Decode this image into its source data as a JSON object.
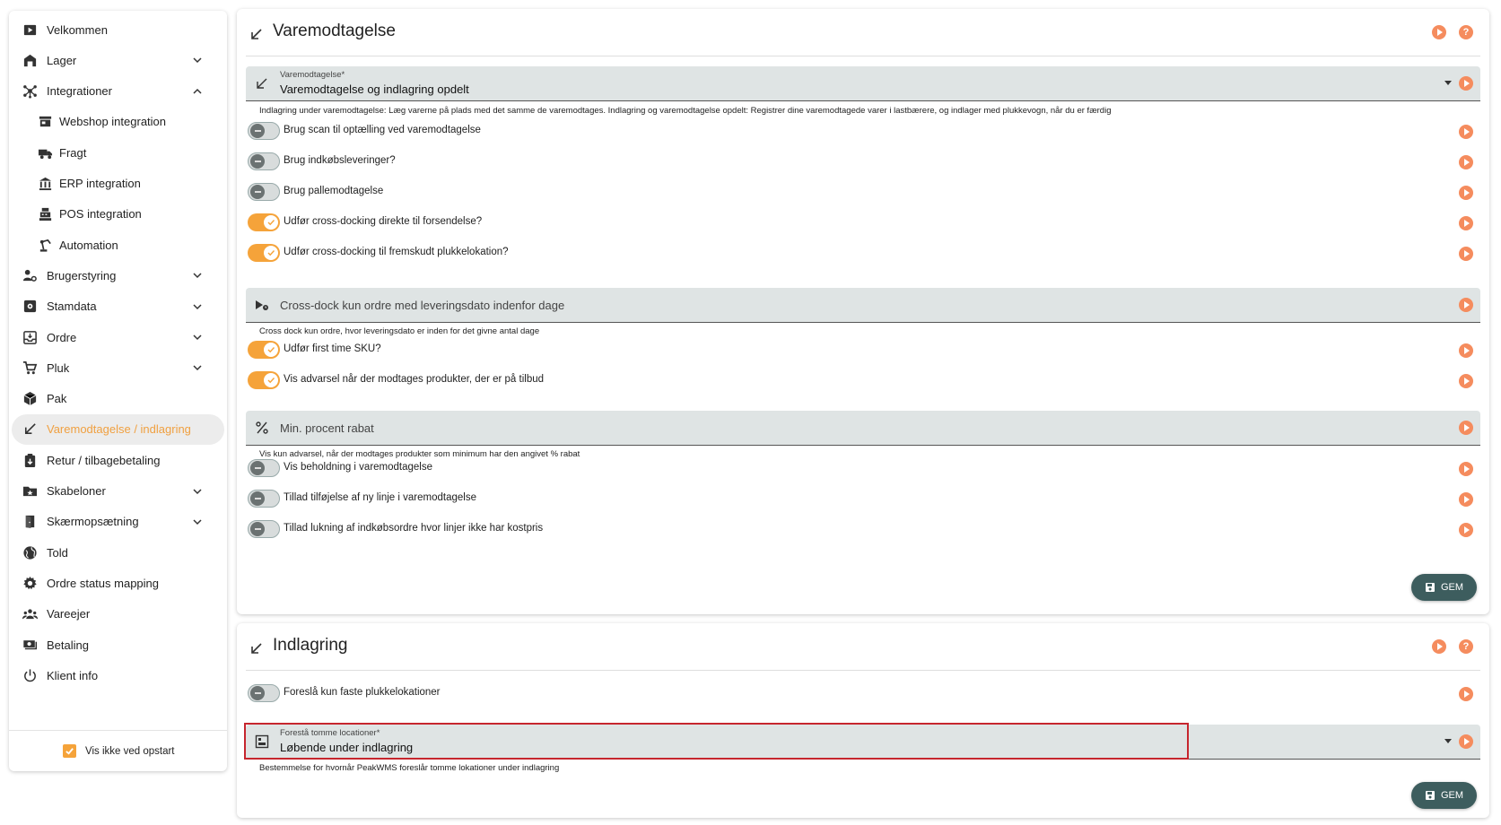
{
  "sidebar": {
    "items": [
      {
        "label": "Velkommen",
        "icon": "play-box-icon",
        "expandable": false,
        "indent": false,
        "active": false
      },
      {
        "label": "Lager",
        "icon": "warehouse-icon",
        "expandable": true,
        "expanded": false,
        "indent": false,
        "active": false
      },
      {
        "label": "Integrationer",
        "icon": "hub-icon",
        "expandable": true,
        "expanded": true,
        "indent": false,
        "active": false
      },
      {
        "label": "Webshop integration",
        "icon": "store-icon",
        "expandable": false,
        "indent": true,
        "active": false
      },
      {
        "label": "Fragt",
        "icon": "truck-icon",
        "expandable": false,
        "indent": true,
        "active": false
      },
      {
        "label": "ERP integration",
        "icon": "bank-icon",
        "expandable": false,
        "indent": true,
        "active": false
      },
      {
        "label": "POS integration",
        "icon": "cash-register-icon",
        "expandable": false,
        "indent": true,
        "active": false
      },
      {
        "label": "Automation",
        "icon": "robot-arm-icon",
        "expandable": false,
        "indent": true,
        "active": false
      },
      {
        "label": "Brugerstyring",
        "icon": "user-gear-icon",
        "expandable": true,
        "expanded": false,
        "indent": false,
        "active": false
      },
      {
        "label": "Stamdata",
        "icon": "gear-box-icon",
        "expandable": true,
        "expanded": false,
        "indent": false,
        "active": false
      },
      {
        "label": "Ordre",
        "icon": "inbox-icon",
        "expandable": true,
        "expanded": false,
        "indent": false,
        "active": false
      },
      {
        "label": "Pluk",
        "icon": "cart-icon",
        "expandable": true,
        "expanded": false,
        "indent": false,
        "active": false
      },
      {
        "label": "Pak",
        "icon": "package-icon",
        "expandable": false,
        "indent": false,
        "active": false
      },
      {
        "label": "Varemodtagelse / indlagring",
        "icon": "arrow-down-left-icon",
        "expandable": false,
        "indent": false,
        "active": true
      },
      {
        "label": "Retur / tilbagebetaling",
        "icon": "clipboard-return-icon",
        "expandable": false,
        "indent": false,
        "active": false
      },
      {
        "label": "Skabeloner",
        "icon": "folder-star-icon",
        "expandable": true,
        "expanded": false,
        "indent": false,
        "active": false
      },
      {
        "label": "Skærmopsætning",
        "icon": "door-icon",
        "expandable": true,
        "expanded": false,
        "indent": false,
        "active": false
      },
      {
        "label": "Told",
        "icon": "globe-icon",
        "expandable": false,
        "indent": false,
        "active": false
      },
      {
        "label": "Ordre status mapping",
        "icon": "gear-icon",
        "expandable": false,
        "indent": false,
        "active": false
      },
      {
        "label": "Vareejer",
        "icon": "people-icon",
        "expandable": false,
        "indent": false,
        "active": false
      },
      {
        "label": "Betaling",
        "icon": "money-icon",
        "expandable": false,
        "indent": false,
        "active": false
      },
      {
        "label": "Klient info",
        "icon": "power-icon",
        "expandable": false,
        "indent": false,
        "active": false
      }
    ],
    "startup_checkbox": {
      "label": "Vis ikke ved opstart",
      "checked": true
    }
  },
  "receiving": {
    "title": "Varemodtagelse",
    "select": {
      "label": "Varemodtagelse*",
      "value": "Varemodtagelse og indlagring opdelt",
      "helper": "Indlagring under varemodtagelse: Læg varerne på plads med det samme de varemodtages. Indlagring og varemodtagelse opdelt: Registrer dine varemodtagede varer i lastbærere, og indlager med plukkevogn, når du er færdig"
    },
    "toggles_a": [
      {
        "label": "Brug scan til optælling ved varemodtagelse",
        "on": false
      },
      {
        "label": "Brug indkøbsleveringer?",
        "on": false
      },
      {
        "label": "Brug pallemodtagelse",
        "on": false
      },
      {
        "label": "Udfør cross-docking direkte til forsendelse?",
        "on": true
      },
      {
        "label": "Udfør cross-docking til fremskudt plukkelokation?",
        "on": true
      }
    ],
    "crossdock_field": {
      "placeholder": "Cross-dock kun ordre med leveringsdato indenfor dage",
      "helper": "Cross dock kun ordre, hvor leveringsdato er inden for det givne antal dage"
    },
    "toggles_b": [
      {
        "label": "Udfør first time SKU?",
        "on": true
      },
      {
        "label": "Vis advarsel når der modtages produkter, der er på tilbud",
        "on": true
      }
    ],
    "discount_field": {
      "placeholder": "Min. procent rabat",
      "helper": "Vis kun advarsel, når der modtages produkter som minimum har den angivet % rabat"
    },
    "toggles_c": [
      {
        "label": "Vis beholdning i varemodtagelse",
        "on": false
      },
      {
        "label": "Tillad tilføjelse af ny linje i varemodtagelse",
        "on": false
      },
      {
        "label": "Tillad lukning af indkøbsordre hvor linjer ikke har kostpris",
        "on": false
      }
    ],
    "save_label": "GEM"
  },
  "putaway": {
    "title": "Indlagring",
    "toggles": [
      {
        "label": "Foreslå kun faste plukkelokationer",
        "on": false
      }
    ],
    "select": {
      "label": "Forestå tomme locationer*",
      "value": "Løbende under indlagring",
      "helper": "Bestemmelse for hvornår PeakWMS foreslår tomme lokationer under indlagring"
    },
    "save_label": "GEM"
  },
  "colors": {
    "accent": "#f5a33a",
    "play_icon": "#f58c5e",
    "field_bg": "#dfe4e4",
    "save_button": "#3d5d5e",
    "highlight_border": "#c6262e"
  }
}
